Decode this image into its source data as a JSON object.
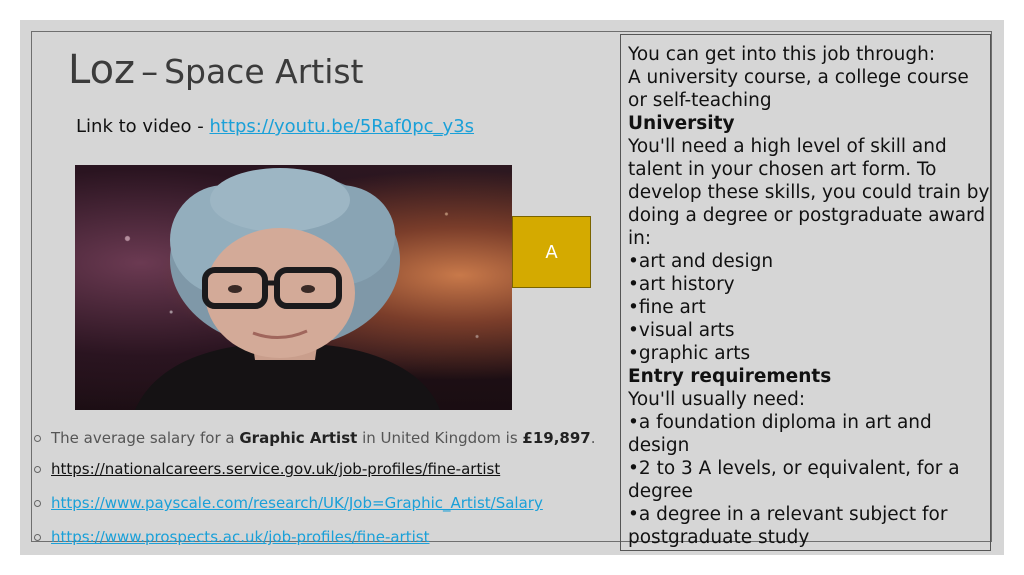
{
  "slide": {
    "title_name": "Loz",
    "title_dash": "–",
    "title_role": "Space Artist",
    "video_label": "Link to video - ",
    "video_link": "https://youtu.be/5Raf0pc_y3s",
    "marker_label": "A",
    "salary": {
      "prefix": "The average salary for a ",
      "job": "Graphic Artist",
      "middle": " in United Kingdom is ",
      "amount": "£19,897",
      "suffix": "."
    },
    "links": [
      "https://nationalcareers.service.gov.uk/job-profiles/fine-artist",
      "https://www.payscale.com/research/UK/Job=Graphic_Artist/Salary",
      "https://www.prospects.ac.uk/job-profiles/fine-artist"
    ],
    "info_lines": [
      {
        "text": "You can get into this job through:",
        "bold": false
      },
      {
        "text": "A university course, a college course or self-teaching",
        "bold": false
      },
      {
        "text": "University",
        "bold": true
      },
      {
        "text": "You'll need a high level of skill and talent in your chosen art form. To develop these skills, you could train by doing a degree or postgraduate award in:",
        "bold": false
      },
      {
        "text": "•art and design",
        "bold": false
      },
      {
        "text": "•art history",
        "bold": false
      },
      {
        "text": "•fine art",
        "bold": false
      },
      {
        "text": "•visual arts",
        "bold": false
      },
      {
        "text": "•graphic arts",
        "bold": false
      },
      {
        "text": "Entry requirements",
        "bold": true
      },
      {
        "text": "You'll usually need:",
        "bold": false
      },
      {
        "text": "•a foundation diploma in art and design",
        "bold": false
      },
      {
        "text": "•2 to 3 A levels, or equivalent, for a degree",
        "bold": false
      },
      {
        "text": "•a degree in a relevant subject for postgraduate study",
        "bold": false
      }
    ]
  }
}
